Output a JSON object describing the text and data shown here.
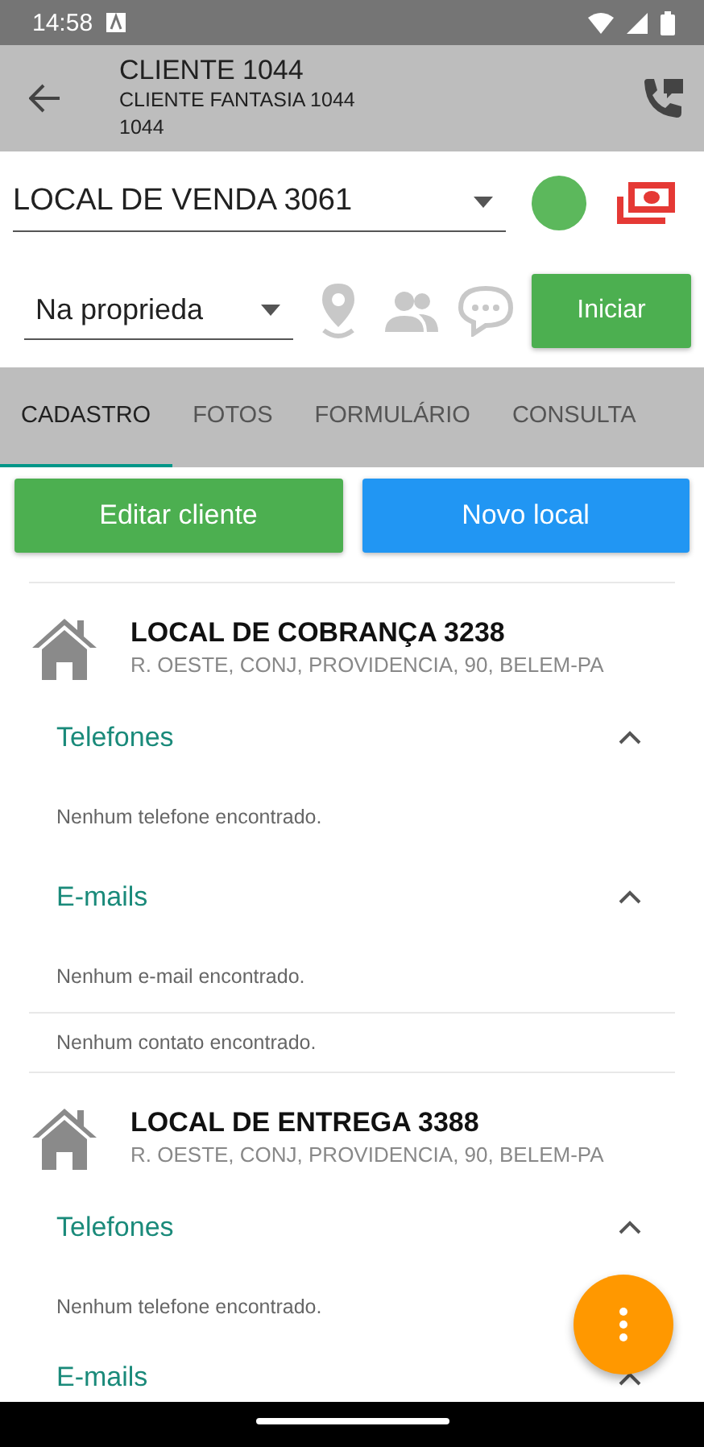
{
  "status_bar": {
    "time": "14:58"
  },
  "header": {
    "title": "CLIENTE 1044",
    "subtitle": "CLIENTE FANTASIA 1044",
    "code": "1044"
  },
  "local_select": {
    "value": "LOCAL DE VENDA 3061"
  },
  "situation_select": {
    "value": "Na proprieda"
  },
  "start_button": {
    "label": "Iniciar"
  },
  "tabs": [
    {
      "label": "CADASTRO",
      "selected": true
    },
    {
      "label": "FOTOS",
      "selected": false
    },
    {
      "label": "FORMULÁRIO",
      "selected": false
    },
    {
      "label": "CONSULTA",
      "selected": false
    }
  ],
  "actions": [
    {
      "label": "Editar cliente",
      "kind": "edit"
    },
    {
      "label": "Novo local",
      "kind": "new"
    }
  ],
  "locations": [
    {
      "title": "LOCAL DE COBRANÇA 3238",
      "address": "R. OESTE, CONJ, PROVIDENCIA, 90, BELEM-PA",
      "sections": [
        {
          "title": "Telefones",
          "expanded": true,
          "empty_text": "Nenhum telefone encontrado."
        },
        {
          "title": "E-mails",
          "expanded": true,
          "empty_text": "Nenhum e-mail encontrado."
        }
      ],
      "contacts_text": "Nenhum contato encontrado."
    },
    {
      "title": "LOCAL DE ENTREGA 3388",
      "address": "R. OESTE, CONJ, PROVIDENCIA, 90, BELEM-PA",
      "sections": [
        {
          "title": "Telefones",
          "expanded": true,
          "empty_text": "Nenhum telefone encontrado."
        },
        {
          "title": "E-mails",
          "expanded": true
        }
      ]
    }
  ]
}
